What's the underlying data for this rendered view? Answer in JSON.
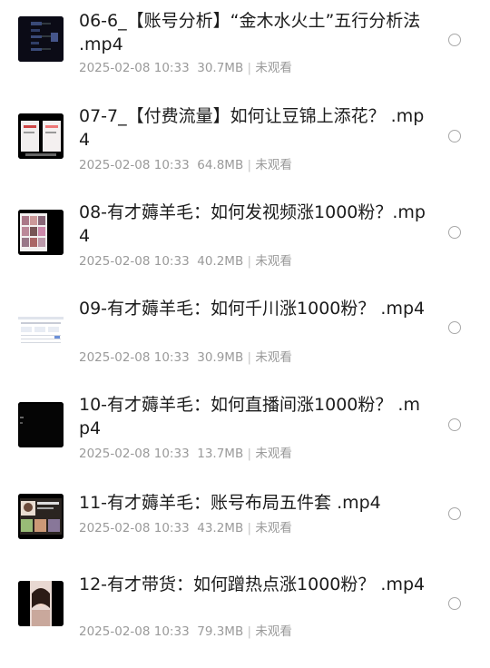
{
  "files": [
    {
      "title": "06-6_【账号分析】“金木水火土”五行分析法 .mp4",
      "date": "2025-02-08 10:33",
      "size": "30.7MB",
      "status": "未观看",
      "thumbnail": "dark-diagram"
    },
    {
      "title": "07-7_【付费流量】如何让豆锦上添花？ .mp4",
      "date": "2025-02-08 10:33",
      "size": "64.8MB",
      "status": "未观看",
      "thumbnail": "phone-screens"
    },
    {
      "title": "08-有才薅羊毛：如何发视频涨1000粉？.mp4",
      "date": "2025-02-08 10:33",
      "size": "40.2MB",
      "status": "未观看",
      "thumbnail": "video-grid"
    },
    {
      "title": "09-有才薅羊毛：如何千川涨1000粉？ .mp4",
      "date": "2025-02-08 10:33",
      "size": "30.9MB",
      "status": "未观看",
      "thumbnail": "web-dashboard"
    },
    {
      "title": "10-有才薅羊毛：如何直播间涨1000粉？ .mp4",
      "date": "2025-02-08 10:33",
      "size": "13.7MB",
      "status": "未观看",
      "thumbnail": "dark-screen"
    },
    {
      "title": "11-有才薅羊毛：账号布局五件套 .mp4",
      "date": "2025-02-08 10:33",
      "size": "43.2MB",
      "status": "未观看",
      "thumbnail": "profile-page"
    },
    {
      "title": "12-有才带货：如何蹭热点涨1000粉？ .mp4",
      "date": "2025-02-08 10:33",
      "size": "79.3MB",
      "status": "未观看",
      "thumbnail": "portrait-photo"
    }
  ],
  "separator": "|"
}
